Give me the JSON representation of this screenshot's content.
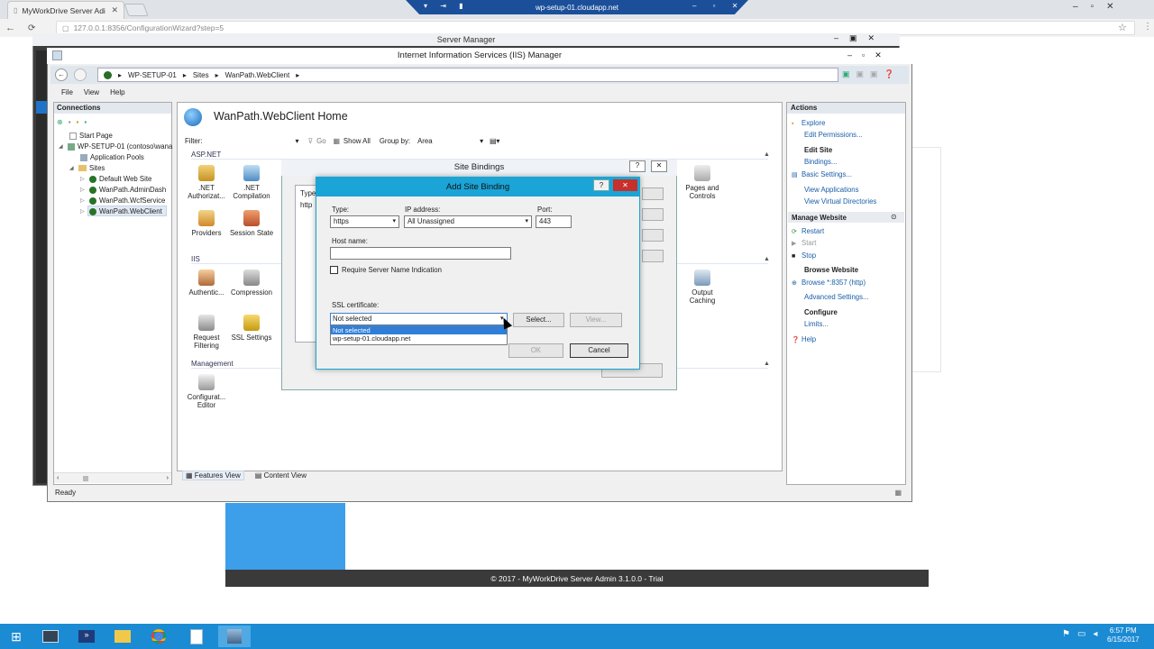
{
  "browser": {
    "tab_title": "MyWorkDrive Server Adi",
    "url": "127.0.0.1:8356/ConfigurationWizard?step=5",
    "remote_host": "wp-setup-01.cloudapp.net"
  },
  "server_manager": {
    "title": "Server Manager"
  },
  "iis": {
    "title": "Internet Information Services (IIS) Manager",
    "breadcrumb": [
      "WP-SETUP-01",
      "Sites",
      "WanPath.WebClient"
    ],
    "menu": [
      "File",
      "View",
      "Help"
    ],
    "status": "Ready"
  },
  "connections": {
    "header": "Connections",
    "tree": [
      "Start Page",
      "WP-SETUP-01 (contoso\\wana",
      "Application Pools",
      "Sites",
      "Default Web Site",
      "WanPath.AdminDash",
      "WanPath.WcfService",
      "WanPath.WebClient"
    ]
  },
  "home": {
    "title": "WanPath.WebClient Home",
    "filter_label": "Filter:",
    "go": "Go",
    "show_all": "Show All",
    "group_by_label": "Group by:",
    "group_by_value": "Area",
    "sections": {
      "aspnet": "ASP.NET",
      "iis": "IIS",
      "management": "Management"
    },
    "features": {
      "net_authorization": ".NET Authorizat...",
      "net_compilation": ".NET Compilation",
      "providers": "Providers",
      "session_state": "Session State",
      "pages_controls": "Pages and Controls",
      "authentication": "Authentic...",
      "compression": "Compression",
      "output_caching": "Output Caching",
      "request_filtering": "Request Filtering",
      "ssl_settings": "SSL Settings",
      "config_editor": "Configurat... Editor"
    },
    "view_tabs": [
      "Features View",
      "Content View"
    ]
  },
  "actions": {
    "header": "Actions",
    "explore": "Explore",
    "edit_permissions": "Edit Permissions...",
    "edit_site": "Edit Site",
    "bindings": "Bindings...",
    "basic_settings": "Basic Settings...",
    "view_applications": "View Applications",
    "view_virtual_directories": "View Virtual Directories",
    "manage_website": "Manage Website",
    "restart": "Restart",
    "start": "Start",
    "stop": "Stop",
    "browse_website": "Browse Website",
    "browse_link": "Browse *:8357 (http)",
    "advanced_settings": "Advanced Settings...",
    "configure": "Configure",
    "limits": "Limits...",
    "help": "Help"
  },
  "site_bindings": {
    "title": "Site Bindings",
    "col_type": "Type",
    "row_type": "http"
  },
  "add_site_binding": {
    "title": "Add Site Binding",
    "type_label": "Type:",
    "type_value": "https",
    "ip_label": "IP address:",
    "ip_value": "All Unassigned",
    "port_label": "Port:",
    "port_value": "443",
    "host_label": "Host name:",
    "host_value": "",
    "sni_label": "Require Server Name Indication",
    "ssl_label": "SSL certificate:",
    "ssl_value": "Not selected",
    "ssl_options": [
      "Not selected",
      "wp-setup-01.cloudapp.net"
    ],
    "select_btn": "Select...",
    "view_btn": "View...",
    "ok_btn": "OK",
    "cancel_btn": "Cancel"
  },
  "footer": "© 2017 - MyWorkDrive Server Admin 3.1.0.0 - Trial",
  "clock": {
    "time": "6:57 PM",
    "date": "6/15/2017"
  }
}
